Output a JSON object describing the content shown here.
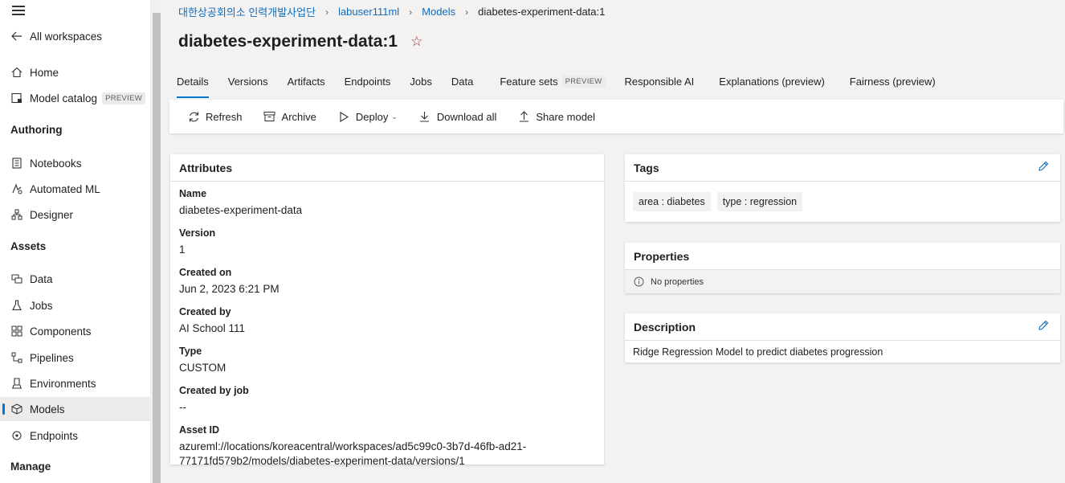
{
  "sidebar": {
    "back_label": "All workspaces",
    "home": "Home",
    "model_catalog": "Model catalog",
    "preview_badge": "PREVIEW",
    "sections": {
      "authoring": "Authoring",
      "assets": "Assets",
      "manage": "Manage"
    },
    "authoring_items": [
      "Notebooks",
      "Automated ML",
      "Designer"
    ],
    "asset_items": [
      "Data",
      "Jobs",
      "Components",
      "Pipelines",
      "Environments",
      "Models",
      "Endpoints"
    ],
    "active_item": "Models"
  },
  "breadcrumb": [
    "대한상공회의소 인력개발사업단",
    "labuser111ml",
    "Models",
    "diabetes-experiment-data:1"
  ],
  "page_title": "diabetes-experiment-data:1",
  "tabs": [
    "Details",
    "Versions",
    "Artifacts",
    "Endpoints",
    "Jobs",
    "Data",
    "Feature sets",
    "Responsible AI",
    "Explanations (preview)",
    "Fairness (preview)"
  ],
  "tab_badge": "PREVIEW",
  "active_tab": "Details",
  "toolbar": {
    "refresh": "Refresh",
    "archive": "Archive",
    "deploy": "Deploy",
    "download_all": "Download all",
    "share_model": "Share model"
  },
  "attributes": {
    "heading": "Attributes",
    "name_label": "Name",
    "name_value": "diabetes-experiment-data",
    "version_label": "Version",
    "version_value": "1",
    "created_on_label": "Created on",
    "created_on_value": "Jun 2, 2023 6:21 PM",
    "created_by_label": "Created by",
    "created_by_value": "AI School 111",
    "type_label": "Type",
    "type_value": "CUSTOM",
    "created_by_job_label": "Created by job",
    "created_by_job_value": "--",
    "asset_id_label": "Asset ID",
    "asset_id_line1": "azureml://locations/koreacentral/workspaces/ad5c99c0-3b7d-46fb-ad21-",
    "asset_id_line2": "77171fd579b2/models/diabetes-experiment-data/versions/1"
  },
  "tags": {
    "heading": "Tags",
    "items": [
      "area : diabetes",
      "type : regression"
    ]
  },
  "properties": {
    "heading": "Properties",
    "empty": "No properties"
  },
  "description": {
    "heading": "Description",
    "text": "Ridge Regression Model to predict diabetes progression"
  },
  "colors": {
    "accent": "#0078d4",
    "link": "#0f6cbd",
    "star": "#a4262c"
  }
}
